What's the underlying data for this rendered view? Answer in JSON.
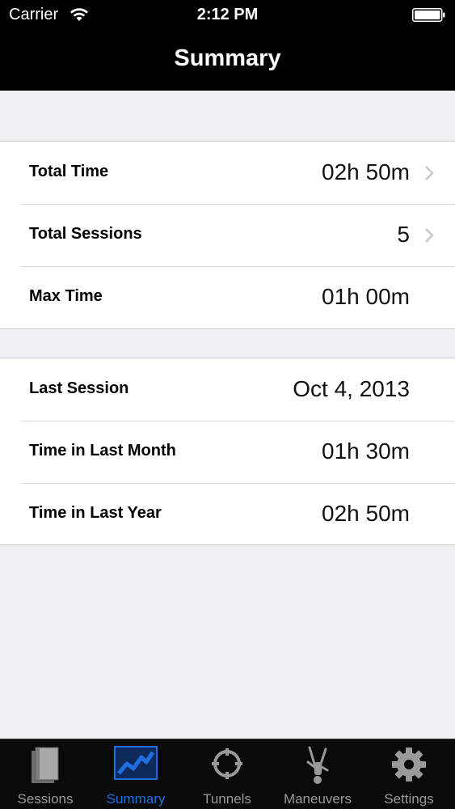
{
  "status_bar": {
    "carrier": "Carrier",
    "time": "2:12 PM",
    "icons": [
      "wifi-icon",
      "battery-icon"
    ]
  },
  "nav": {
    "title": "Summary"
  },
  "sections": [
    {
      "rows": [
        {
          "label": "Total Time",
          "value": "02h 50m",
          "disclosure": true
        },
        {
          "label": "Total Sessions",
          "value": "5",
          "disclosure": true
        },
        {
          "label": "Max Time",
          "value": "01h 00m",
          "disclosure": false
        }
      ]
    },
    {
      "rows": [
        {
          "label": "Last Session",
          "value": "Oct 4, 2013",
          "disclosure": false
        },
        {
          "label": "Time in Last Month",
          "value": "01h 30m",
          "disclosure": false
        },
        {
          "label": "Time in Last Year",
          "value": "02h 50m",
          "disclosure": false
        }
      ]
    }
  ],
  "tabbar": {
    "active": "Summary",
    "tabs": [
      {
        "label": "Sessions",
        "icon": "book-icon"
      },
      {
        "label": "Summary",
        "icon": "chart-icon"
      },
      {
        "label": "Tunnels",
        "icon": "crosshair-icon"
      },
      {
        "label": "Maneuvers",
        "icon": "skydiver-icon"
      },
      {
        "label": "Settings",
        "icon": "gear-icon"
      }
    ]
  },
  "colors": {
    "accent": "#1f6fe0",
    "background": "#efeff4",
    "bar": "#000000",
    "tab_inactive": "#9a9a9a"
  }
}
